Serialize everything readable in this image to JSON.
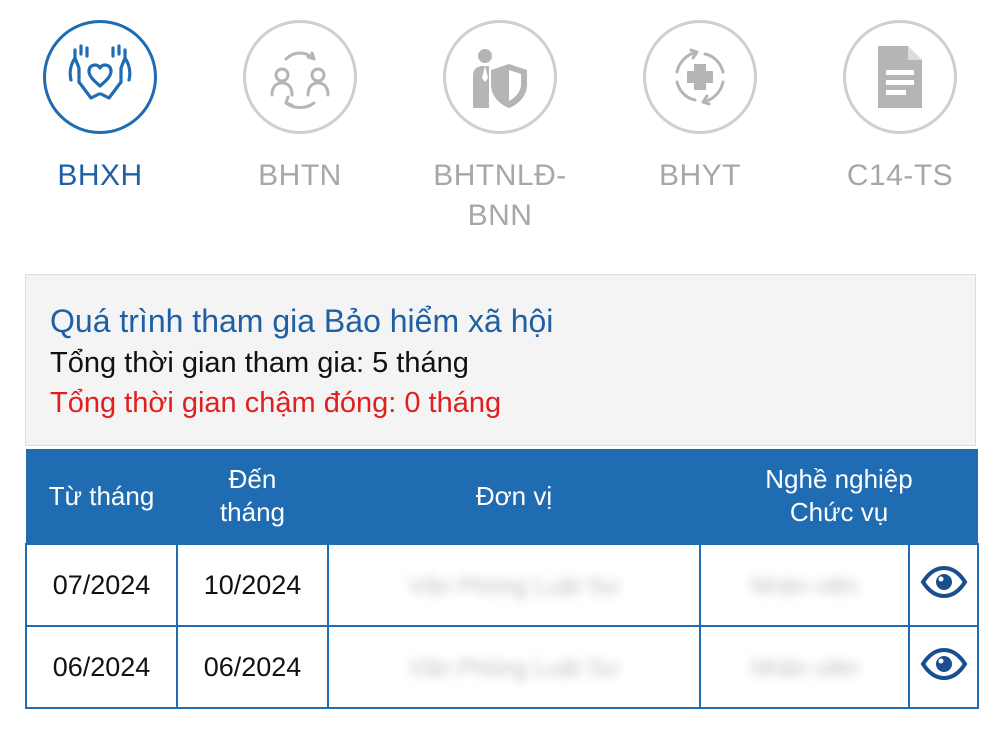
{
  "tabs": [
    {
      "label": "BHXH",
      "icon": "hands-heart-icon",
      "active": true
    },
    {
      "label": "BHTN",
      "icon": "people-exchange-icon",
      "active": false
    },
    {
      "label": "BHTNLĐ-BNN",
      "icon": "worker-shield-icon",
      "active": false
    },
    {
      "label": "BHYT",
      "icon": "medical-cross-icon",
      "active": false
    },
    {
      "label": "C14-TS",
      "icon": "document-icon",
      "active": false
    }
  ],
  "summary": {
    "title": "Quá trình tham gia Bảo hiểm xã hội",
    "total_participation": "Tổng thời gian tham gia: 5 tháng",
    "total_late": "Tổng thời gian chậm đóng: 0 tháng"
  },
  "table": {
    "headers": {
      "from_month": "Từ tháng",
      "to_month_line1": "Đến",
      "to_month_line2": "tháng",
      "unit": "Đơn vị",
      "occupation_line1": "Nghề nghiệp",
      "occupation_line2": "Chức vụ"
    },
    "rows": [
      {
        "from": "07/2024",
        "to": "10/2024",
        "unit": "Văn Phòng Luật Sư",
        "occupation": "Nhân viên"
      },
      {
        "from": "06/2024",
        "to": "06/2024",
        "unit": "Văn Phòng Luật Sư",
        "occupation": "Nhân viên"
      }
    ]
  },
  "colors": {
    "primary": "#1f6cb3",
    "inactive": "#a7a7a7",
    "late_text": "#e02020",
    "card_bg": "#f4f4f4"
  }
}
